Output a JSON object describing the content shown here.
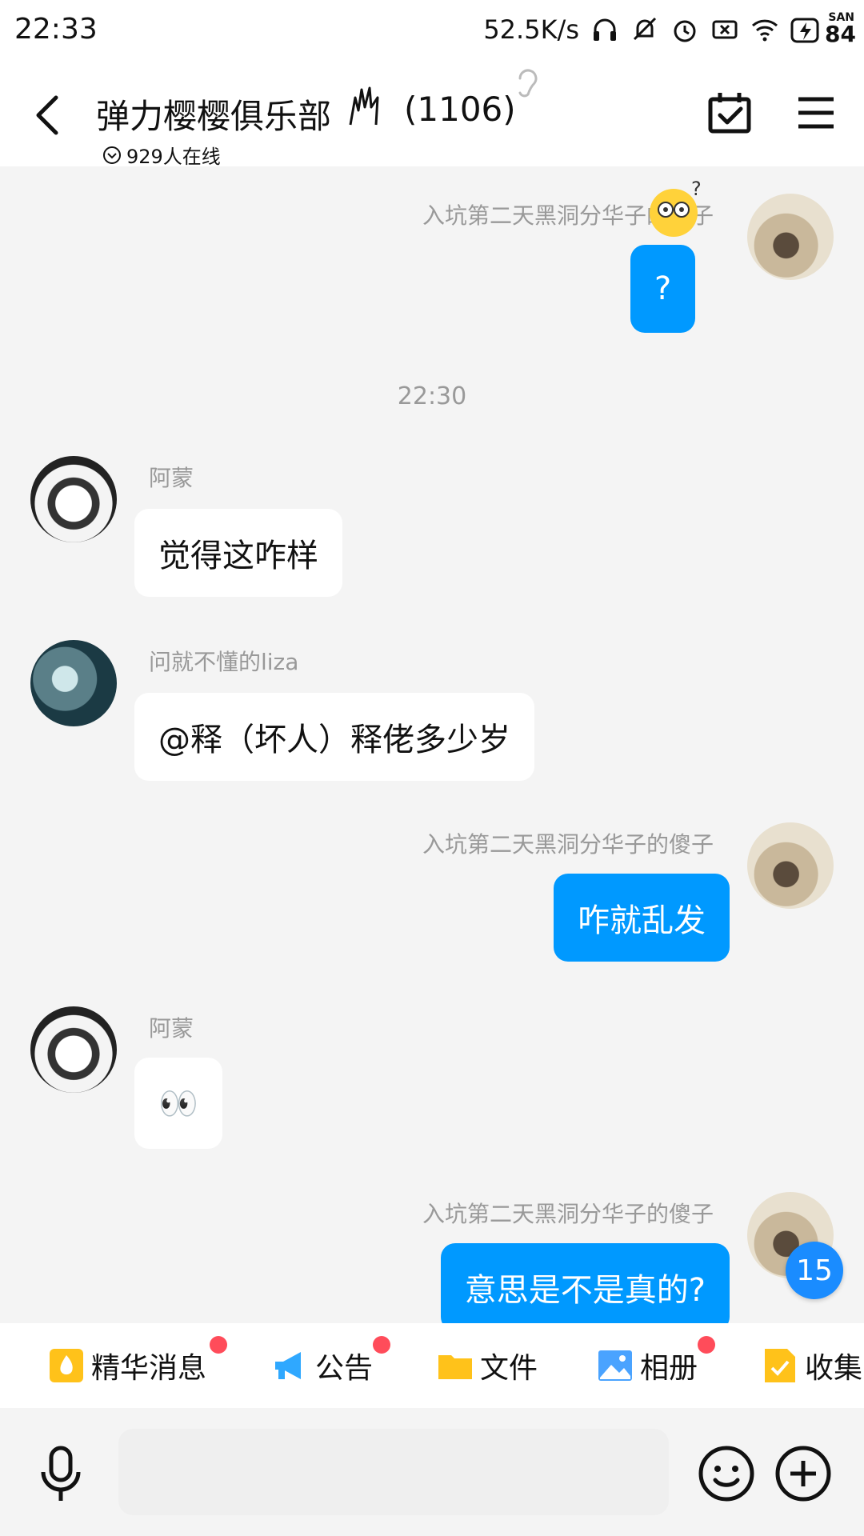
{
  "status_bar": {
    "time": "22:33",
    "net_speed": "52.5K/s",
    "battery_label": "SAN",
    "battery_level": "84"
  },
  "header": {
    "title": "弹力樱樱俱乐部",
    "member_count": "(1106)",
    "online_text": "929人在线"
  },
  "messages": [
    {
      "side": "right",
      "sender": "入坑第二天黑洞分华子的傻子",
      "text": "?"
    },
    {
      "timestamp": "22:30"
    },
    {
      "side": "left",
      "sender": "阿蒙",
      "text": "觉得这咋样"
    },
    {
      "side": "left",
      "sender": "问就不懂的liza",
      "text": "@释（坏人）释佬多少岁"
    },
    {
      "side": "right",
      "sender": "入坑第二天黑洞分华子的傻子",
      "text": "咋就乱发"
    },
    {
      "side": "left",
      "sender": "阿蒙",
      "text": "👀"
    },
    {
      "side": "right",
      "sender": "入坑第二天黑洞分华子的傻子",
      "text": "意思是不是真的?"
    }
  ],
  "unread_badge": "15",
  "toolbar": {
    "items": [
      {
        "label": "精华消息",
        "icon": "flame-icon",
        "has_dot": true
      },
      {
        "label": "公告",
        "icon": "megaphone-icon",
        "has_dot": true
      },
      {
        "label": "文件",
        "icon": "folder-icon",
        "has_dot": false
      },
      {
        "label": "相册",
        "icon": "photo-icon",
        "has_dot": true
      },
      {
        "label": "收集",
        "icon": "checklist-icon",
        "has_dot": false
      }
    ]
  },
  "colors": {
    "accent": "#0099ff",
    "background": "#f4f4f4",
    "badge": "#1a8cff",
    "dot": "#ff4c5a"
  }
}
